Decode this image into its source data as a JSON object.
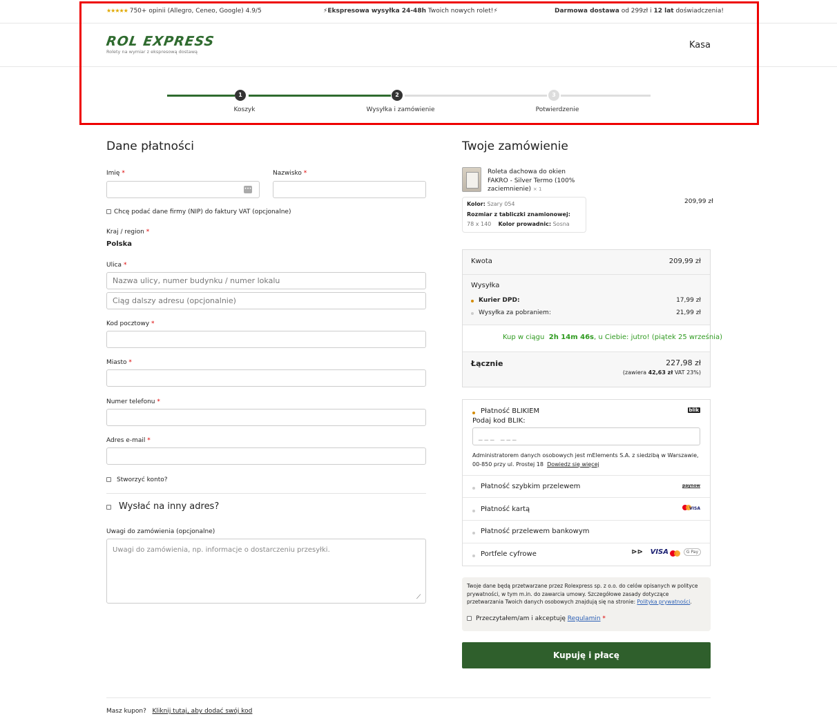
{
  "topbar": {
    "stars": "★★★★★",
    "reviews": "750+ opinii (Allegro, Ceneo, Google) 4.9/5",
    "express_bold": "Ekspresowa wysyłka 24-48h",
    "express_rest": "Twoich nowych rolet!",
    "delivery_bold": "Darmowa dostawa",
    "delivery_mid": "od 299zł i",
    "years_bold": "12 lat",
    "years_rest": "doświadczenia!"
  },
  "header": {
    "logo": "ROL EXPRESS",
    "tagline": "Rolety na wymiar z ekspresową dostawą",
    "kasa": "Kasa"
  },
  "steps": [
    {
      "num": "1",
      "label": "Koszyk"
    },
    {
      "num": "2",
      "label": "Wysyłka i zamówienie"
    },
    {
      "num": "3",
      "label": "Potwierdzenie"
    }
  ],
  "billing": {
    "title": "Dane płatności",
    "first_name": "Imię",
    "last_name": "Nazwisko",
    "company_checkbox": "Chcę podać dane firmy (NIP) do faktury VAT",
    "company_optional": "(opcjonalne)",
    "country_label": "Kraj / region",
    "country_value": "Polska",
    "street_label": "Ulica",
    "street_placeholder": "Nazwa ulicy, numer budynku / numer lokalu",
    "street2_placeholder": "Ciąg dalszy adresu (opcjonalnie)",
    "postcode_label": "Kod pocztowy",
    "city_label": "Miasto",
    "phone_label": "Numer telefonu",
    "email_label": "Adres e-mail",
    "create_account": "Stworzyć konto?",
    "ship_other": "Wysłać na inny adres?",
    "notes_label": "Uwagi do zamówienia",
    "notes_optional": "(opcjonalne)",
    "notes_placeholder": "Uwagi do zamówienia, np. informacje o dostarczeniu przesyłki.",
    "required_mark": "*"
  },
  "order": {
    "title": "Twoje zamówienie",
    "product_name_1": "Roleta dachowa do okien",
    "product_name_2": "FAKRO - Silver Termo (100%",
    "product_name_3": "zaciemnienie)",
    "qty": "× 1",
    "product_price": "209,99 zł",
    "attr_color_label": "Kolor:",
    "attr_color_value": "Szary 054",
    "attr_size_label": "Rozmiar z tabliczki znamionowej:",
    "attr_size_value": "78 x 140",
    "attr_guide_label": "Kolor prowadnic:",
    "attr_guide_value": "Sosna",
    "amount_label": "Kwota",
    "amount_value": "209,99 zł",
    "shipping_label": "Wysyłka",
    "ship1_label": "Kurier DPD:",
    "ship1_price": "17,99 zł",
    "ship2_label": "Wysyłka za pobraniem:",
    "ship2_price": "21,99 zł",
    "timer_pre": "Kup w ciągu",
    "timer_value": "2h 14m 46s",
    "timer_post": ", u Ciebie: jutro! (piątek 25 września)",
    "total_label": "Łącznie",
    "total_value": "227,98 zł",
    "vat_pre": "(zawiera",
    "vat_value": "42,63 zł",
    "vat_post": "VAT 23%)"
  },
  "payment": {
    "blik_name": "Płatność BLIKIEM",
    "blik_logo": "blik",
    "blik_code_label": "Podaj kod BLIK:",
    "blik_placeholder": "___ ___",
    "blik_info": "Administratorem danych osobowych jest mElements S.A. z siedzibą w Warszawie, 00-850 przy ul. Prostej 18",
    "blik_more": "Dowiedz się więcej",
    "fast_transfer": "Płatność szybkim przelewem",
    "paynow_logo": "paynow",
    "card": "Płatność kartą",
    "visa_logo": "VISA",
    "bank_transfer": "Płatność przelewem bankowym",
    "wallets": "Portfele cyfrowe",
    "gpay_logo": "G Pay"
  },
  "terms": {
    "text": "Twoje dane będą przetwarzane przez Rolexpress sp. z o.o. do celów opisanych w polityce prywatności, w tym m.in. do zawarcia umowy. Szczegółowe zasady dotyczące przetwarzania Twoich danych osobowych znajdują się na stronie:",
    "policy_link": "Polityka prywatności",
    "accept_pre": "Przeczytałem/am i akceptuję",
    "accept_link": "Regulamin",
    "button": "Kupuję i płacę"
  },
  "coupon": {
    "question": "Masz kupon?",
    "link": "Kliknij tutaj, aby dodać swój kod"
  },
  "colors": {
    "brand_green": "#2f6b2f",
    "button_green": "#2f5f2c",
    "timer_green": "#2e9a1f",
    "radio_selected": "#d38b00",
    "highlight_red": "#ee0000"
  }
}
